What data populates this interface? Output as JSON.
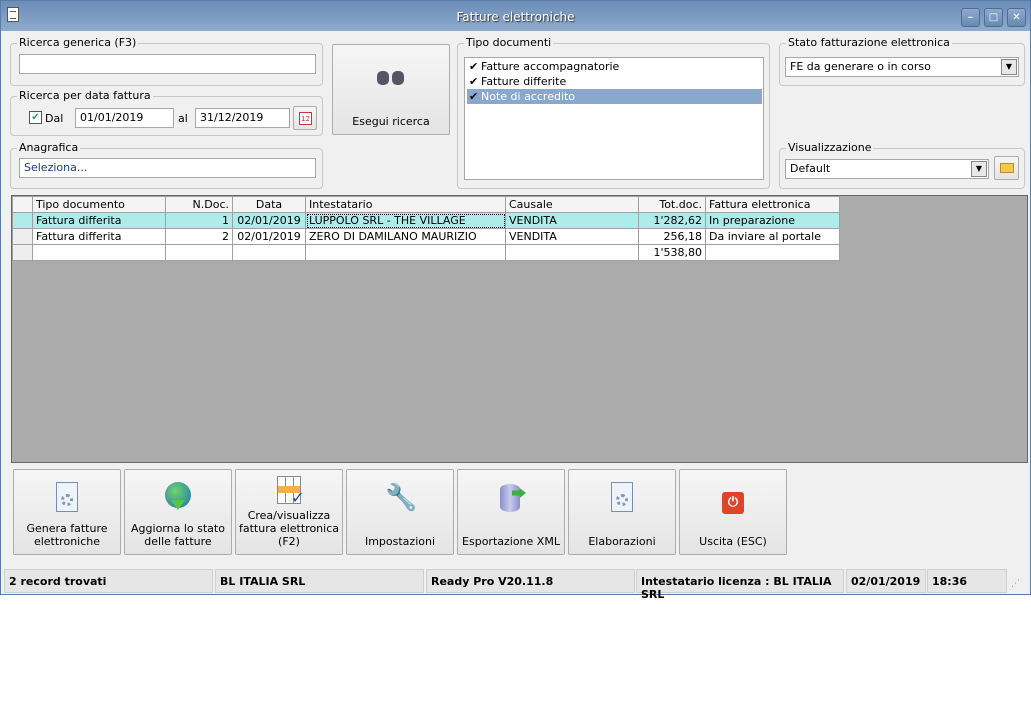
{
  "window": {
    "title": "Fatture elettroniche",
    "minimize": "–",
    "maximize": "□",
    "close": "✕"
  },
  "search": {
    "generic_label": "Ricerca generica (F3)",
    "generic_value": "",
    "date_label": "Ricerca per data fattura",
    "dal_checked": true,
    "dal_label": "Dal",
    "date_from": "01/01/2019",
    "al_label": "al",
    "date_to": "31/12/2019",
    "anagrafica_label": "Anagrafica",
    "anagrafica_value": "Seleziona...",
    "search_button": "Esegui ricerca"
  },
  "tipo_documenti": {
    "label": "Tipo documenti",
    "items": [
      {
        "label": "Fatture accompagnatorie",
        "checked": true
      },
      {
        "label": "Fatture differite",
        "checked": true
      },
      {
        "label": "Note di accredito",
        "checked": true,
        "selected": true
      }
    ]
  },
  "stato": {
    "label": "Stato fatturazione elettronica",
    "value": "FE da generare o in corso"
  },
  "visualizzazione": {
    "label": "Visualizzazione",
    "value": "Default"
  },
  "table": {
    "columns": [
      "Tipo documento",
      "N.Doc.",
      "Data",
      "Intestatario",
      "Causale",
      "Tot.doc.",
      "Fattura elettronica"
    ],
    "rows": [
      [
        "Fattura differita",
        "1",
        "02/01/2019",
        "LUPPOLO SRL - THE VILLAGE",
        "VENDITA",
        "1'282,62",
        "In preparazione"
      ],
      [
        "Fattura differita",
        "2",
        "02/01/2019",
        "ZERO DI DAMILANO MAURIZIO",
        "VENDITA",
        "256,18",
        "Da inviare al portale"
      ]
    ],
    "total": "1'538,80"
  },
  "actions": [
    "Genera fatture elettroniche",
    "Aggiorna lo stato delle fatture",
    "Crea/visualizza fattura elettronica (F2)",
    "Impostazioni",
    "Esportazione XML",
    "Elaborazioni",
    "Uscita (ESC)"
  ],
  "statusbar": [
    "2 record trovati",
    "BL ITALIA SRL",
    "Ready Pro V20.11.8",
    "Intestatario licenza : BL ITALIA SRL",
    "02/01/2019",
    "18:36"
  ]
}
